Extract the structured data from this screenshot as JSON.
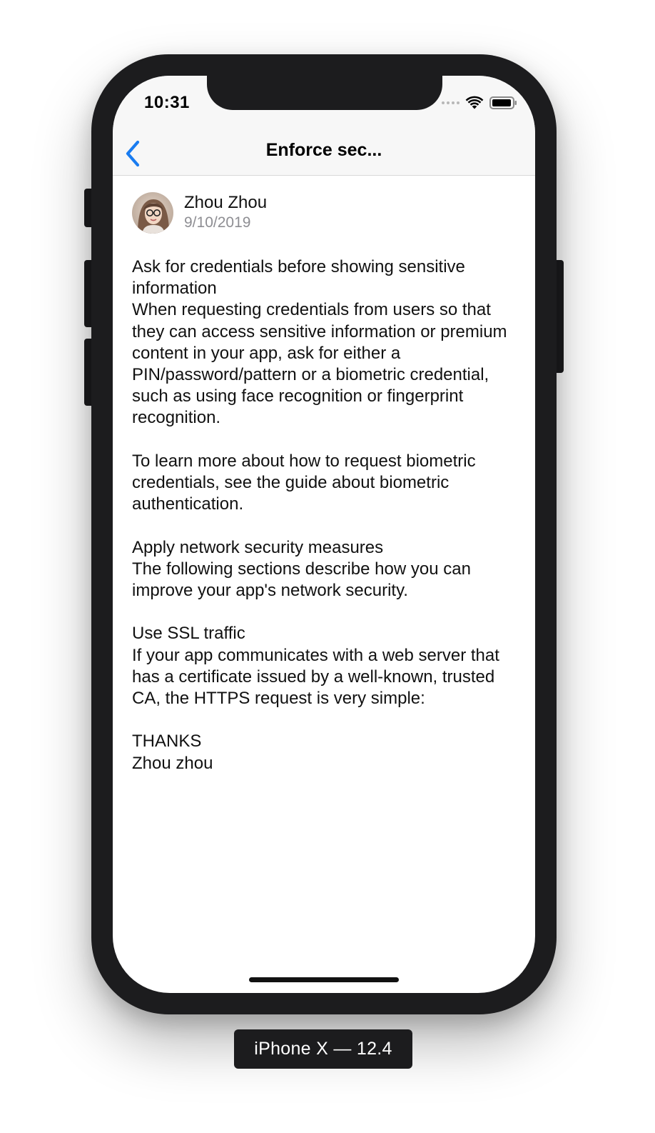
{
  "status_bar": {
    "time": "10:31"
  },
  "nav": {
    "title": "Enforce sec...",
    "back_icon": "chevron-left-icon",
    "accent_color": "#1a7cf0"
  },
  "post": {
    "author_name": "Zhou Zhou",
    "date": "9/10/2019",
    "paragraphs": [
      "Ask for credentials before showing sensitive information",
      "When requesting credentials from users so that they can access sensitive information or premium content in your app, ask for either a PIN/password/pattern or a biometric credential, such as using face recognition or fingerprint recognition.",
      "",
      "To learn more about how to request biometric credentials, see the guide about biometric authentication.",
      "",
      "Apply network security measures",
      "The following sections describe how you can improve your app's network security.",
      "",
      "Use SSL traffic",
      "If your app communicates with a web server that has a certificate issued by a well-known, trusted CA, the HTTPS request is very simple:",
      "",
      "THANKS",
      "Zhou zhou"
    ]
  },
  "device_label": "iPhone X — 12.4"
}
